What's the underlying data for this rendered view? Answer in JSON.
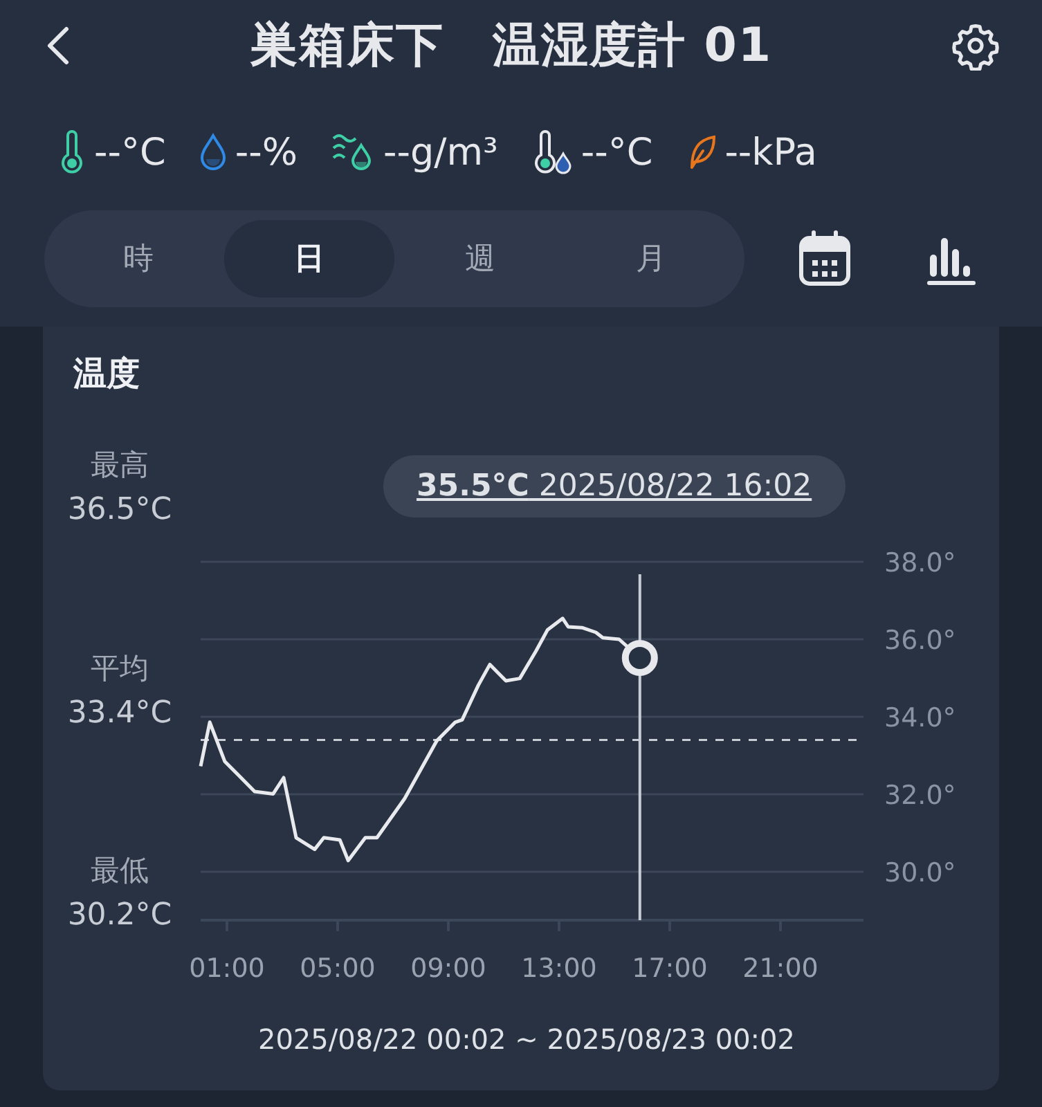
{
  "header": {
    "title": "巣箱床下　温湿度計 01"
  },
  "metrics": [
    {
      "kind": "temperature",
      "text": "--°C"
    },
    {
      "kind": "humidity",
      "text": "--%"
    },
    {
      "kind": "absolute-humidity",
      "text": "--g/m³"
    },
    {
      "kind": "dew-point",
      "text": "--°C"
    },
    {
      "kind": "vpd",
      "text": "--kPa"
    }
  ],
  "tabs": [
    {
      "label": "時",
      "selected": false
    },
    {
      "label": "日",
      "selected": true
    },
    {
      "label": "週",
      "selected": false
    },
    {
      "label": "月",
      "selected": false
    }
  ],
  "card": {
    "stats": [
      {
        "label": "最高",
        "value": "36.5°C"
      },
      {
        "label": "平均",
        "value": "33.4°C"
      },
      {
        "label": "最低",
        "value": "30.2°C"
      }
    ],
    "tooltip": "**35.5°C** 2025/08/22 16:02",
    "chart_data": {
      "type": "line",
      "x": [
        0.05,
        0.38,
        0.92,
        1.42,
        2.0,
        2.67,
        3.05,
        3.5,
        4.17,
        4.5,
        5.08,
        5.38,
        6.0,
        6.42,
        7.42,
        8.58,
        9.25,
        9.5,
        10.08,
        10.5,
        11.08,
        11.58,
        12.17,
        12.58,
        13.13,
        13.33,
        13.83,
        14.33,
        14.58,
        15.17,
        15.92
      ],
      "series": [
        {
          "name": "温度",
          "color": "#e8eaee",
          "values": [
            32.72,
            33.86,
            32.85,
            32.49,
            32.07,
            32.01,
            32.43,
            30.88,
            30.58,
            30.88,
            30.82,
            30.29,
            30.88,
            30.88,
            31.89,
            33.38,
            33.86,
            33.92,
            34.81,
            35.35,
            34.93,
            34.99,
            35.7,
            36.24,
            36.54,
            36.32,
            36.3,
            36.18,
            36.04,
            36.0,
            35.52
          ]
        }
      ],
      "xlim": [
        0,
        24
      ],
      "ylim": [
        28.75,
        38
      ],
      "grid": true,
      "xticks": [
        {
          "value": 1,
          "label": "01:00"
        },
        {
          "value": 5,
          "label": "05:00"
        },
        {
          "value": 9,
          "label": "09:00"
        },
        {
          "value": 13,
          "label": "13:00"
        },
        {
          "value": 17,
          "label": "17:00"
        },
        {
          "value": 21,
          "label": "21:00"
        }
      ],
      "yticks": [
        {
          "value": 30,
          "label": "30.0°"
        },
        {
          "value": 32,
          "label": "32.0°"
        },
        {
          "value": 34,
          "label": "34.0°"
        },
        {
          "value": 36,
          "label": "36.0°"
        },
        {
          "value": 38,
          "label": "38.0°"
        }
      ],
      "ref_lines": [
        {
          "axis": "y",
          "value": 33.4
        },
        {
          "axis": "x",
          "value": 15.92
        }
      ]
    },
    "range": "2025/08/22 00:02 ~ 2025/08/23 00:02"
  }
}
